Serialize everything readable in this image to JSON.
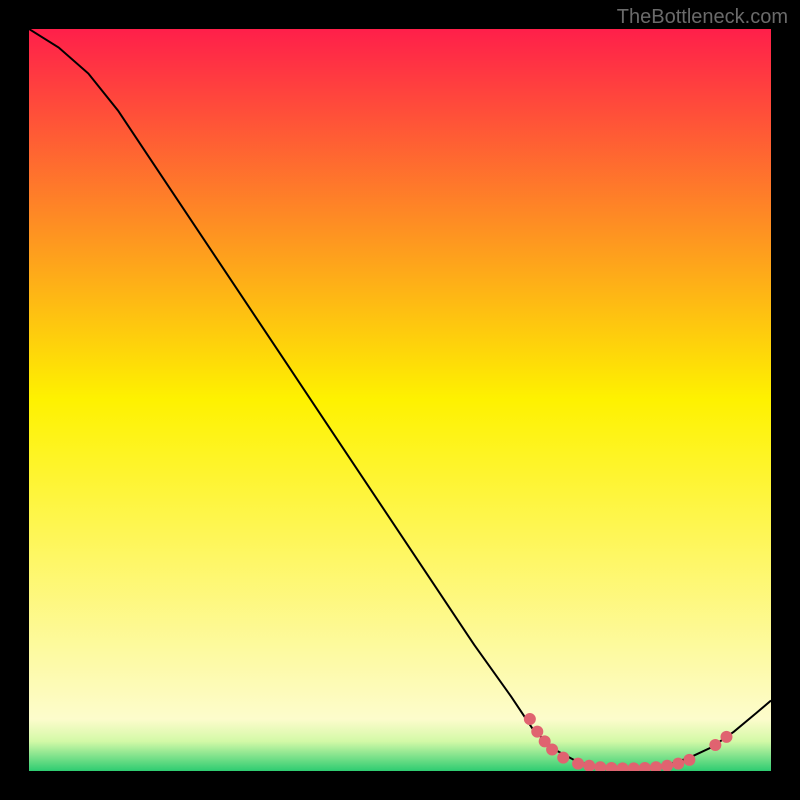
{
  "watermark": "TheBottleneck.com",
  "chart_data": {
    "type": "line",
    "title": "",
    "xlabel": "",
    "ylabel": "",
    "xlim": [
      0,
      100
    ],
    "ylim": [
      0,
      100
    ],
    "background_gradient": {
      "stops": [
        {
          "offset": 0,
          "color": "#ff1f4a"
        },
        {
          "offset": 50,
          "color": "#fef200"
        },
        {
          "offset": 93,
          "color": "#fdfccc"
        },
        {
          "offset": 96,
          "color": "#d3f9a7"
        },
        {
          "offset": 100,
          "color": "#2ecc71"
        }
      ]
    },
    "series": [
      {
        "name": "curve",
        "stroke": "#000000",
        "stroke_width": 2,
        "points": [
          {
            "x": 0,
            "y": 100
          },
          {
            "x": 4,
            "y": 97.5
          },
          {
            "x": 8,
            "y": 94
          },
          {
            "x": 12,
            "y": 89
          },
          {
            "x": 16,
            "y": 83
          },
          {
            "x": 20,
            "y": 77
          },
          {
            "x": 25,
            "y": 69.5
          },
          {
            "x": 30,
            "y": 62
          },
          {
            "x": 35,
            "y": 54.5
          },
          {
            "x": 40,
            "y": 47
          },
          {
            "x": 45,
            "y": 39.5
          },
          {
            "x": 50,
            "y": 32
          },
          {
            "x": 55,
            "y": 24.5
          },
          {
            "x": 60,
            "y": 17
          },
          {
            "x": 65,
            "y": 10
          },
          {
            "x": 68,
            "y": 5.5
          },
          {
            "x": 71,
            "y": 2.8
          },
          {
            "x": 74,
            "y": 1.2
          },
          {
            "x": 77,
            "y": 0.5
          },
          {
            "x": 80,
            "y": 0.3
          },
          {
            "x": 83,
            "y": 0.4
          },
          {
            "x": 86,
            "y": 0.8
          },
          {
            "x": 89,
            "y": 1.8
          },
          {
            "x": 92,
            "y": 3.2
          },
          {
            "x": 95,
            "y": 5.3
          },
          {
            "x": 98,
            "y": 7.8
          },
          {
            "x": 100,
            "y": 9.5
          }
        ]
      }
    ],
    "markers": {
      "color": "#e06370",
      "radius": 6,
      "points": [
        {
          "x": 67.5,
          "y": 7.0
        },
        {
          "x": 68.5,
          "y": 5.3
        },
        {
          "x": 69.5,
          "y": 4.0
        },
        {
          "x": 70.5,
          "y": 2.9
        },
        {
          "x": 72.0,
          "y": 1.8
        },
        {
          "x": 74.0,
          "y": 1.0
        },
        {
          "x": 75.5,
          "y": 0.7
        },
        {
          "x": 77.0,
          "y": 0.5
        },
        {
          "x": 78.5,
          "y": 0.4
        },
        {
          "x": 80.0,
          "y": 0.35
        },
        {
          "x": 81.5,
          "y": 0.35
        },
        {
          "x": 83.0,
          "y": 0.4
        },
        {
          "x": 84.5,
          "y": 0.5
        },
        {
          "x": 86.0,
          "y": 0.7
        },
        {
          "x": 87.5,
          "y": 1.0
        },
        {
          "x": 89.0,
          "y": 1.5
        },
        {
          "x": 92.5,
          "y": 3.5
        },
        {
          "x": 94.0,
          "y": 4.6
        }
      ]
    }
  }
}
